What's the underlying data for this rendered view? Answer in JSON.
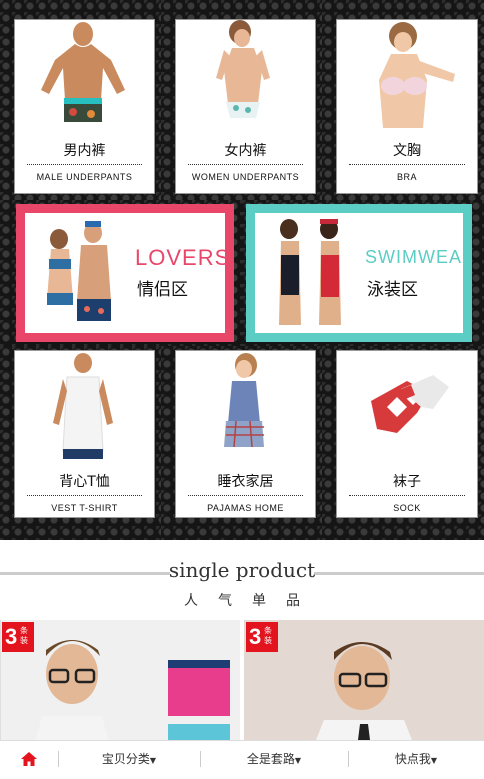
{
  "categories_row1": [
    {
      "zh": "男内裤",
      "en": "MALE UNDERPANTS",
      "icon": "male-underwear-model"
    },
    {
      "zh": "女内裤",
      "en": "WOMEN UNDERPANTS",
      "icon": "female-underwear-model"
    },
    {
      "zh": "文胸",
      "en": "BRA",
      "icon": "bra-model"
    }
  ],
  "banners": [
    {
      "en": "LOVERS",
      "zh": "情侣区",
      "color": "#e9476a"
    },
    {
      "en": "SWIMWEAR",
      "zh": "泳装区",
      "color": "#5ccdc4"
    }
  ],
  "categories_row2": [
    {
      "zh": "背心T恤",
      "en": "VEST T-SHIRT",
      "icon": "vest-model"
    },
    {
      "zh": "睡衣家居",
      "en": "PAJAMAS HOME",
      "icon": "pajama-model"
    },
    {
      "zh": "袜子",
      "en": "SOCK",
      "icon": "socks"
    }
  ],
  "single_product": {
    "title": "single product",
    "subtitle": "人气单品"
  },
  "products": [
    {
      "badge_number": "3",
      "badge_text": "条装"
    },
    {
      "badge_number": "3",
      "badge_text": "条装"
    }
  ],
  "bottom_nav": {
    "home_icon": "home-icon",
    "items": [
      "宝贝分类",
      "全是套路",
      "快点我"
    ]
  },
  "colors": {
    "accent": "#e3141e",
    "lovers": "#e9476a",
    "swimwear": "#5ccdc4"
  }
}
